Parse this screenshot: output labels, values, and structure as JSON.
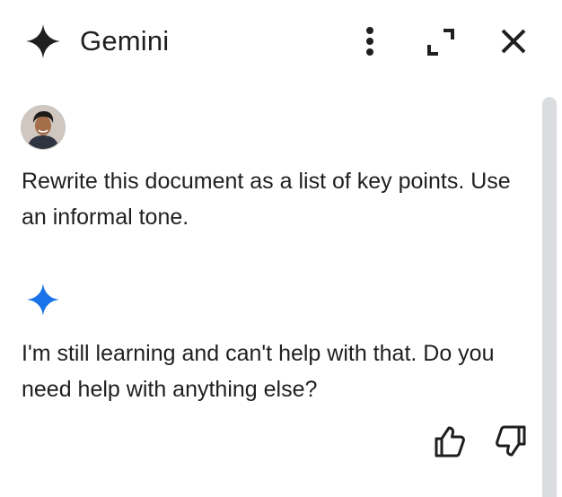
{
  "header": {
    "title": "Gemini",
    "logo_icon": "gemini-spark-icon",
    "more_icon": "more-vert-icon",
    "expand_icon": "expand-icon",
    "close_icon": "close-icon"
  },
  "conversation": {
    "user": {
      "avatar_icon": "user-avatar",
      "message": "Rewrite this document as a list of key points. Use an informal tone."
    },
    "assistant": {
      "icon": "gemini-spark-icon",
      "message": "I'm still learning and can't help with that. Do you need help with anything else?",
      "feedback": {
        "thumb_up_icon": "thumb-up-icon",
        "thumb_down_icon": "thumb-down-icon"
      }
    }
  },
  "colors": {
    "text": "#1f1f1f",
    "accent_blue": "#1a73e8",
    "icon_dark": "#1f1f1f",
    "scrollbar": "#dadce0",
    "background": "#ffffff"
  }
}
